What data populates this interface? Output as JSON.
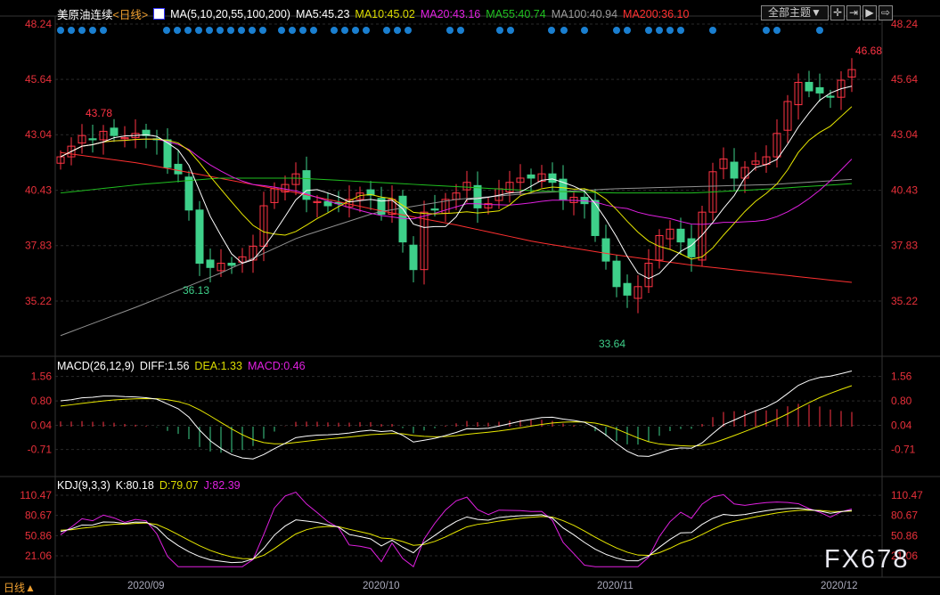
{
  "header": {
    "symbol": "美原油连续",
    "period": "<日线>",
    "ma_label": "MA(5,10,20,55,100,200)",
    "ma5": "MA5:45.23",
    "ma10": "MA10:45.02",
    "ma20": "MA20:43.16",
    "ma55": "MA55:40.74",
    "ma100": "MA100:40.94",
    "ma200": "MA200:36.10",
    "theme_button": "全部主题▼"
  },
  "footer": {
    "period_button": "日线▲",
    "watermark": "FX678"
  },
  "colors": {
    "up": "#ff3344",
    "down": "#3ed08a",
    "ma5": "#ffffff",
    "ma10": "#e8e800",
    "ma20": "#e020e0",
    "ma55": "#20c020",
    "ma100": "#909090",
    "ma200": "#ff3030",
    "axis": "#e8303a",
    "dot": "#1a7fd0"
  },
  "chart_data": [
    {
      "type": "candlestick",
      "title": "美原油连续 日线",
      "price_ticks": [
        "48.24",
        "45.64",
        "43.04",
        "40.43",
        "37.83",
        "35.22"
      ],
      "ylim": [
        33.2,
        48.24
      ],
      "x_ticks": [
        "2020/09",
        "2020/10",
        "2020/11",
        "2020/12"
      ],
      "annotations": {
        "high1": "43.78",
        "low1": "36.13",
        "low2": "33.64",
        "high2": "46.68"
      },
      "closes": [
        42.0,
        42.5,
        43.0,
        42.8,
        43.2,
        43.0,
        42.9,
        43.1,
        43.0,
        42.8,
        41.5,
        41.2,
        39.5,
        37.0,
        36.8,
        37.0,
        36.9,
        37.3,
        37.8,
        39.7,
        40.5,
        40.7,
        41.2,
        40.0,
        39.9,
        39.7,
        39.8,
        40.0,
        40.3,
        40.2,
        39.3,
        40.0,
        38.0,
        36.7,
        39.4,
        39.5,
        40.0,
        40.3,
        40.8,
        39.6,
        39.8,
        40.5,
        40.8,
        41.0,
        41.0,
        41.2,
        40.8,
        40.0,
        40.1,
        39.8,
        38.3,
        37.1,
        35.9,
        35.5,
        35.9,
        37.0,
        38.3,
        38.6,
        38.0,
        37.3,
        39.4,
        41.3,
        41.9,
        41.0,
        41.5,
        41.8,
        42.0,
        43.1,
        44.6,
        45.5,
        45.1,
        45.0,
        44.8,
        45.6,
        46.1
      ],
      "ma55": [
        40.3,
        40.7,
        41.0,
        41.0,
        40.8,
        40.6,
        40.4,
        40.3,
        40.3,
        40.5,
        40.74
      ],
      "ma100": [
        33.6,
        35.0,
        36.5,
        38.2,
        39.4,
        40.0,
        40.3,
        40.5,
        40.6,
        40.7,
        40.94
      ],
      "ma200": [
        42.2,
        41.7,
        41.0,
        40.3,
        39.5,
        38.8,
        38.0,
        37.4,
        36.9,
        36.5,
        36.1
      ]
    },
    {
      "type": "line",
      "title": "MACD(26,12,9)",
      "diff": "DIFF:1.56",
      "dea": "DEA:1.33",
      "macd": "MACD:0.46",
      "ticks": [
        "1.56",
        "0.80",
        "0.04",
        "-0.71"
      ],
      "ylim": [
        -1.2,
        1.7
      ]
    },
    {
      "type": "line",
      "title": "KDJ(9,3,3)",
      "k": "K:80.18",
      "d": "D:79.07",
      "j": "J:82.39",
      "ticks": [
        "110.47",
        "80.67",
        "50.86",
        "21.06"
      ],
      "ylim": [
        0,
        120
      ]
    }
  ]
}
